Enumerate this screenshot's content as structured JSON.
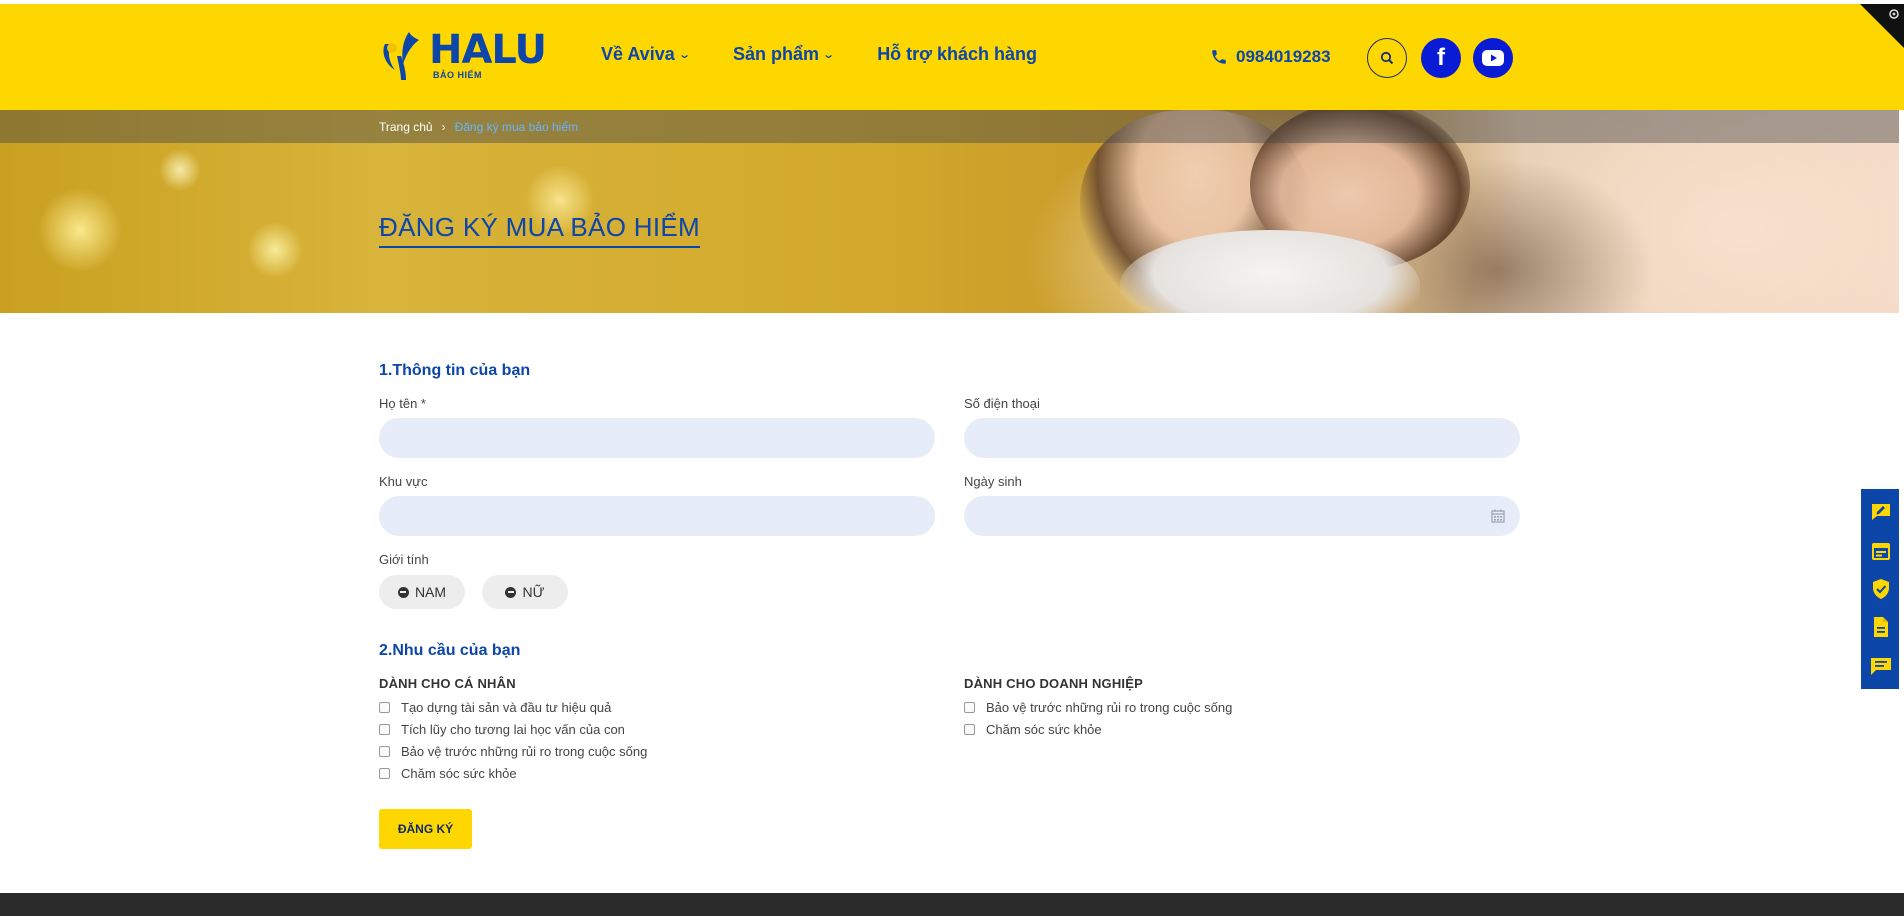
{
  "header": {
    "logo": {
      "word": "HALU",
      "sub": "BẢO HIỂM"
    },
    "nav": [
      {
        "label": "Về Aviva",
        "has_dropdown": true
      },
      {
        "label": "Sản phẩm",
        "has_dropdown": true
      },
      {
        "label": "Hỗ trợ khách hàng",
        "has_dropdown": false
      }
    ],
    "phone": "0984019283",
    "icons": [
      "phone-icon",
      "search-icon",
      "facebook-icon",
      "youtube-icon"
    ]
  },
  "breadcrumb": {
    "home": "Trang chủ",
    "current": "Đăng ký mua bảo hiểm"
  },
  "banner": {
    "title": "ĐĂNG KÝ MUA BẢO HIỂM"
  },
  "form": {
    "section1": "1.Thông tin của bạn",
    "fields": {
      "name": {
        "label": "Họ tên *",
        "value": ""
      },
      "phone": {
        "label": "Số điện thoại",
        "value": ""
      },
      "region": {
        "label": "Khu vực",
        "value": ""
      },
      "birthday": {
        "label": "Ngày sinh",
        "value": ""
      }
    },
    "gender": {
      "label": "Giới tính",
      "options": [
        "NAM",
        "NỮ"
      ]
    },
    "section2": "2.Nhu cầu của bạn",
    "individual": {
      "title": "DÀNH CHO CÁ NHÂN",
      "options": [
        "Tạo dựng tài sản và đầu tư hiệu quả",
        "Tích lũy cho tương lai học vấn của con",
        "Bảo vệ trước những rủi ro trong cuộc sống",
        "Chăm sóc sức khỏe"
      ]
    },
    "business": {
      "title": "DÀNH CHO DOANH NGHIỆP",
      "options": [
        "Bảo vệ trước những rủi ro trong cuộc sống",
        "Chăm sóc sức khỏe"
      ]
    },
    "submit": "ĐĂNG KÝ"
  },
  "side_bar": {
    "icons": [
      "feedback-icon",
      "calendar-icon",
      "shield-check-icon",
      "document-icon",
      "chat-icon"
    ]
  },
  "colors": {
    "brand_yellow": "#ffd700",
    "brand_blue": "#0c46a8",
    "input_bg": "#e6edf8",
    "social_blue": "#0a1bd6",
    "footer": "#2b2b2b"
  }
}
